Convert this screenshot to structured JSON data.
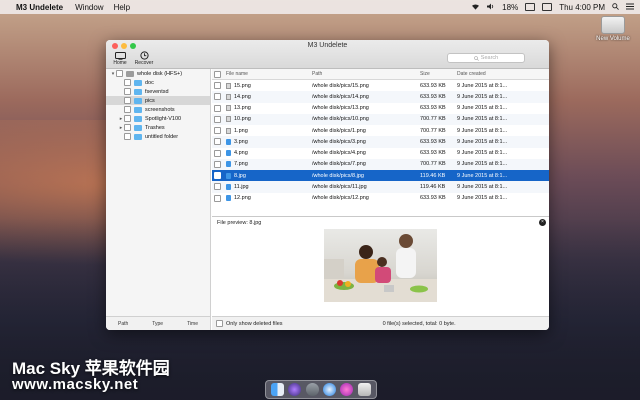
{
  "menubar": {
    "apple": "",
    "app_name": "M3 Undelete",
    "items": [
      "Window",
      "Help"
    ],
    "battery": "18%",
    "clock": "Thu 4:00 PM"
  },
  "desktop": {
    "volume_label": "New Volume"
  },
  "window": {
    "title": "M3 Undelete",
    "toolbar": {
      "home": "Home",
      "recover": "Recover"
    },
    "search_placeholder": "Search"
  },
  "sidebar": {
    "tree": [
      {
        "label": "whole disk (HFS+)",
        "arrow": "▾",
        "depth": 0,
        "icon": "disk",
        "selected": false
      },
      {
        "label": "doc",
        "arrow": "",
        "depth": 1,
        "icon": "folder",
        "selected": false
      },
      {
        "label": "fseventsd",
        "arrow": "",
        "depth": 1,
        "icon": "folder",
        "selected": false
      },
      {
        "label": "pics",
        "arrow": "",
        "depth": 1,
        "icon": "folder",
        "selected": true
      },
      {
        "label": "screenshots",
        "arrow": "",
        "depth": 1,
        "icon": "folder",
        "selected": false
      },
      {
        "label": "Spotlight-V100",
        "arrow": "▸",
        "depth": 1,
        "icon": "folder",
        "selected": false
      },
      {
        "label": "Trashes",
        "arrow": "▸",
        "depth": 1,
        "icon": "folder",
        "selected": false
      },
      {
        "label": "untitled folder",
        "arrow": "",
        "depth": 1,
        "icon": "folder",
        "selected": false
      }
    ],
    "footer": [
      "Path",
      "Type",
      "Time"
    ]
  },
  "table": {
    "headers": {
      "name": "File name",
      "path": "Path",
      "size": "Size",
      "date": "Date created"
    },
    "rows": [
      {
        "name": "15.png",
        "path": "/whole disk/pics/15.png",
        "size": "633.93 KB",
        "date": "9 June 2015 at 8:1...",
        "type": "png",
        "selected": false
      },
      {
        "name": "14.png",
        "path": "/whole disk/pics/14.png",
        "size": "633.93 KB",
        "date": "9 June 2015 at 8:1...",
        "type": "png",
        "selected": false
      },
      {
        "name": "13.png",
        "path": "/whole disk/pics/13.png",
        "size": "633.93 KB",
        "date": "9 June 2015 at 8:1...",
        "type": "png",
        "selected": false
      },
      {
        "name": "10.png",
        "path": "/whole disk/pics/10.png",
        "size": "700.77 KB",
        "date": "9 June 2015 at 8:1...",
        "type": "png",
        "selected": false
      },
      {
        "name": "1.png",
        "path": "/whole disk/pics/1.png",
        "size": "700.77 KB",
        "date": "9 June 2015 at 8:1...",
        "type": "png",
        "selected": false
      },
      {
        "name": "3.png",
        "path": "/whole disk/pics/3.png",
        "size": "633.93 KB",
        "date": "9 June 2015 at 8:1...",
        "type": "jpg",
        "selected": false
      },
      {
        "name": "4.png",
        "path": "/whole disk/pics/4.png",
        "size": "633.93 KB",
        "date": "9 June 2015 at 8:1...",
        "type": "jpg",
        "selected": false
      },
      {
        "name": "7.png",
        "path": "/whole disk/pics/7.png",
        "size": "700.77 KB",
        "date": "9 June 2015 at 8:1...",
        "type": "jpg",
        "selected": false
      },
      {
        "name": "8.jpg",
        "path": "/whole disk/pics/8.jpg",
        "size": "119.46 KB",
        "date": "9 June 2015 at 8:1...",
        "type": "jpg",
        "selected": true
      },
      {
        "name": "11.jpg",
        "path": "/whole disk/pics/11.jpg",
        "size": "119.46 KB",
        "date": "9 June 2015 at 8:1...",
        "type": "jpg",
        "selected": false
      },
      {
        "name": "12.png",
        "path": "/whole disk/pics/12.png",
        "size": "633.93 KB",
        "date": "9 June 2015 at 8:1...",
        "type": "jpg",
        "selected": false
      }
    ]
  },
  "preview": {
    "label": "File preview: 8.jpg"
  },
  "status": {
    "only_deleted": "Only show deleted files",
    "summary": "0 file(s) selected, total: 0 byte."
  },
  "watermark": {
    "line1": "Mac Sky 苹果软件园",
    "line2": "www.macsky.net"
  },
  "colors": {
    "selection": "#1665c8",
    "folder": "#5fb5ef"
  }
}
